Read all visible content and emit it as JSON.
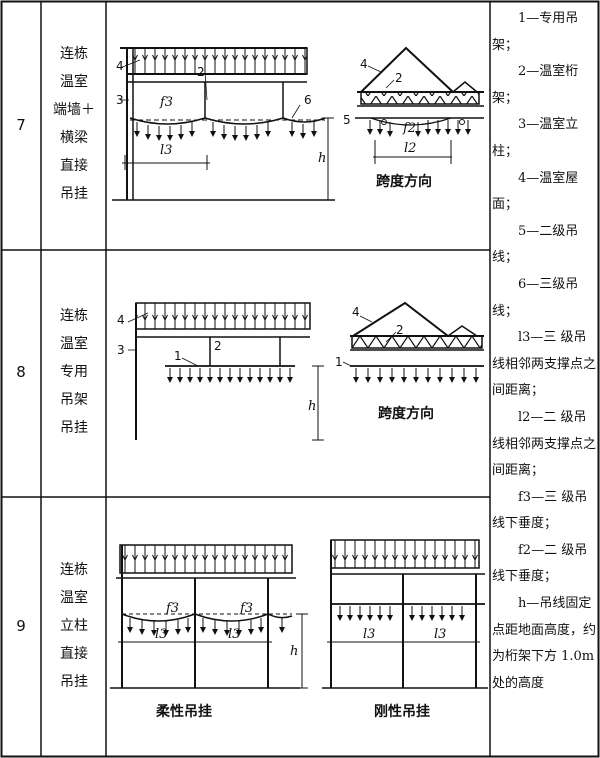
{
  "rows": [
    {
      "no": "7",
      "lines": [
        "连栋",
        "温室",
        "端墙＋",
        "横梁",
        "直接",
        "吊挂"
      ],
      "caption": "跨度方向"
    },
    {
      "no": "8",
      "lines": [
        "连栋",
        "温室",
        "专用",
        "吊架",
        "吊挂"
      ],
      "caption": "跨度方向"
    },
    {
      "no": "9",
      "lines": [
        "连栋",
        "温室",
        "立柱",
        "直接",
        "吊挂"
      ],
      "captions": [
        "柔性吊挂",
        "刚性吊挂"
      ]
    }
  ],
  "labels": {
    "n1": "1",
    "n2": "2",
    "n3": "3",
    "n4": "4",
    "n5": "5",
    "n6": "6",
    "f3": "f3",
    "f2": "f2",
    "l3": "l3",
    "l2": "l2",
    "h": "h"
  },
  "legend": [
    "1—专用吊架；",
    "2—温室桁架；",
    "3—温室立柱；",
    "4—温室屋面；",
    "5—二级吊线；",
    "6—三级吊线；",
    "l3—三 级吊线相邻两支撑点之间距离；",
    "l2—二 级吊线相邻两支撑点之间距离；",
    "f3—三 级吊线下垂度；",
    "f2—二 级吊线下垂度；",
    "h—吊线固定点距地面高度，约为桁架下方 1.0m 处的高度"
  ]
}
